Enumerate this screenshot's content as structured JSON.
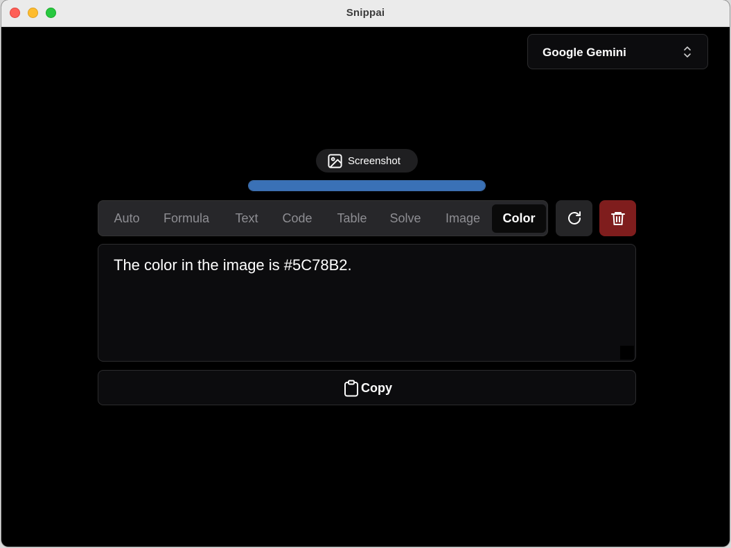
{
  "window": {
    "title": "Snippai"
  },
  "model_select": {
    "value": "Google Gemini",
    "icon": "chevron-up-down-icon"
  },
  "screenshot": {
    "label": "Screenshot",
    "icon": "image-icon"
  },
  "progress": {
    "value": 1.0,
    "color": "#3a71b6"
  },
  "tabs": [
    {
      "label": "Auto"
    },
    {
      "label": "Formula"
    },
    {
      "label": "Text"
    },
    {
      "label": "Code"
    },
    {
      "label": "Table"
    },
    {
      "label": "Solve"
    },
    {
      "label": "Image"
    },
    {
      "label": "Color"
    }
  ],
  "active_tab": "Color",
  "actions": {
    "refresh_icon": "refresh-icon",
    "delete_icon": "trash-icon",
    "delete_color": "#7f1d1d"
  },
  "output": {
    "text": "The color in the image is #5C78B2."
  },
  "copy_button": {
    "label": "Copy",
    "icon": "clipboard-icon"
  }
}
